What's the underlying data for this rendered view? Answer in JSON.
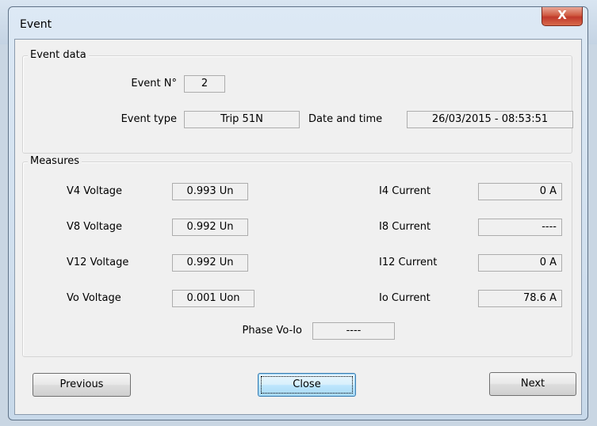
{
  "window": {
    "title": "Event",
    "close_glyph": "X"
  },
  "event_data": {
    "legend": "Event data",
    "number_label": "Event N°",
    "number_value": "2",
    "type_label": "Event type",
    "type_value": "Trip 51N",
    "datetime_label": "Date and time",
    "datetime_value": "26/03/2015 - 08:53:51"
  },
  "measures": {
    "legend": "Measures",
    "v4_label": "V4 Voltage",
    "v4_value": "0.993 Un",
    "v8_label": "V8 Voltage",
    "v8_value": "0.992 Un",
    "v12_label": "V12 Voltage",
    "v12_value": "0.992 Un",
    "vo_label": "Vo Voltage",
    "vo_value": "0.001 Uon",
    "i4_label": "I4 Current",
    "i4_value": "0 A",
    "i8_label": "I8 Current",
    "i8_value": "----",
    "i12_label": "I12 Current",
    "i12_value": "0 A",
    "io_label": "Io Current",
    "io_value": "78.6 A",
    "phase_label": "Phase Vo-Io",
    "phase_value": "----"
  },
  "buttons": {
    "previous": "Previous",
    "close": "Close",
    "next": "Next"
  }
}
